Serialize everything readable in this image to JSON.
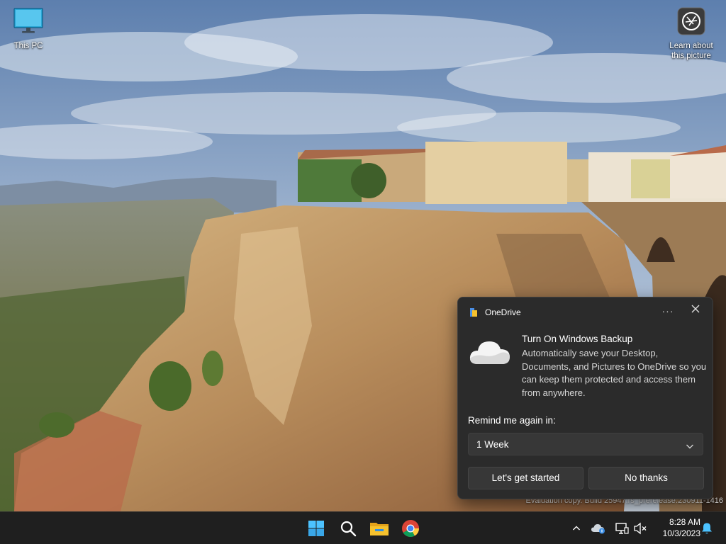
{
  "desktop": {
    "icons": [
      {
        "label": "This PC",
        "icon": "monitor-icon"
      },
      {
        "label": "Learn about this picture",
        "icon": "camera-icon"
      }
    ],
    "watermark": "Evaluation copy. Build 25947.rs_prerelease.230911-1416"
  },
  "toast": {
    "app_name": "OneDrive",
    "more_label": "···",
    "title": "Turn On Windows Backup",
    "body": "Automatically save your Desktop, Documents, and Pictures to OneDrive so you can keep them protected and access them from anywhere.",
    "remind_label": "Remind me again in:",
    "remind_value": "1 Week",
    "primary_button": "Let's get started",
    "secondary_button": "No thanks"
  },
  "taskbar": {
    "apps": [
      "start-icon",
      "search-icon",
      "file-explorer-icon",
      "chrome-icon"
    ],
    "time": "8:28 AM",
    "date": "10/3/2023"
  },
  "colors": {
    "taskbar_bg": "#1f1f1f",
    "toast_bg": "#2b2b2b",
    "start_blue": "#4cc2ff",
    "folder_yellow": "#f5c12e"
  }
}
